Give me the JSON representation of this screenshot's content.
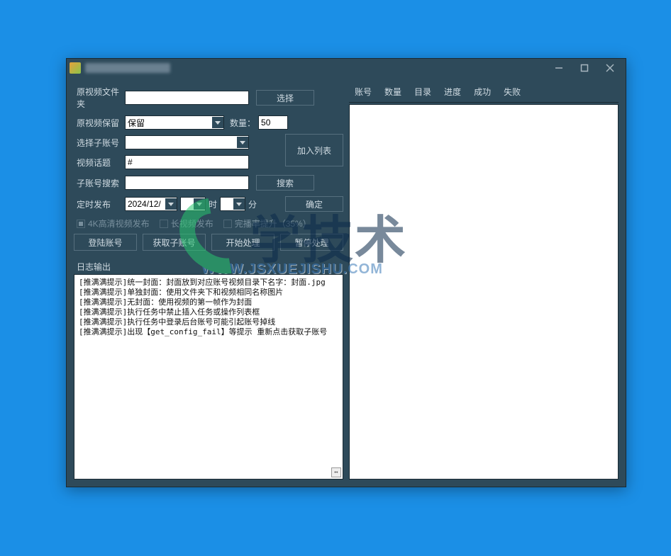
{
  "titlebar": {
    "title_blurred": true
  },
  "form": {
    "folder_label": "原视频文件夹",
    "folder_value": "",
    "select_btn": "选择",
    "keep_label": "原视频保留",
    "keep_value": "保留",
    "qty_label": "数量：",
    "qty_value": "50",
    "subacct_label": "选择子账号",
    "subacct_value": "",
    "addlist_btn": "加入列表",
    "topic_label": "视频话题",
    "topic_value": "#",
    "search_label": "子账号搜索",
    "search_value": "",
    "search_btn": "搜索",
    "sched_label": "定时发布",
    "sched_date": "2024/12/",
    "hour_label": "时",
    "min_label": "分",
    "confirm_btn": "确定",
    "chk_4k": "4K高清视频发布",
    "chk_long": "长视频发布",
    "chk_boost": "完播率提升（35%）",
    "btn_login": "登陆账号",
    "btn_getsub": "获取子账号",
    "btn_start": "开始处理",
    "btn_pause": "暂停处理"
  },
  "log": {
    "label": "日志输出",
    "lines": [
      "[推满满提示]统一封面：封面放到对应账号视频目录下名字：封面.jpg",
      "[推满满提示]单独封面：使用文件夹下和视频相同名称图片",
      "[推满满提示]无封面：使用视频的第一帧作为封面",
      "[推满满提示]执行任务中禁止插入任务或操作列表框",
      "[推满满提示]执行任务中登录后台账号可能引起账号掉线",
      "[推满满提示]出现【get_config_fail】等提示 重新点击获取子账号"
    ]
  },
  "table": {
    "headers": [
      "账号",
      "数量",
      "目录",
      "进度",
      "成功",
      "失败"
    ]
  },
  "watermark": {
    "brand": "学技术",
    "url": "WWW.JSXUEJISHU.COM"
  }
}
